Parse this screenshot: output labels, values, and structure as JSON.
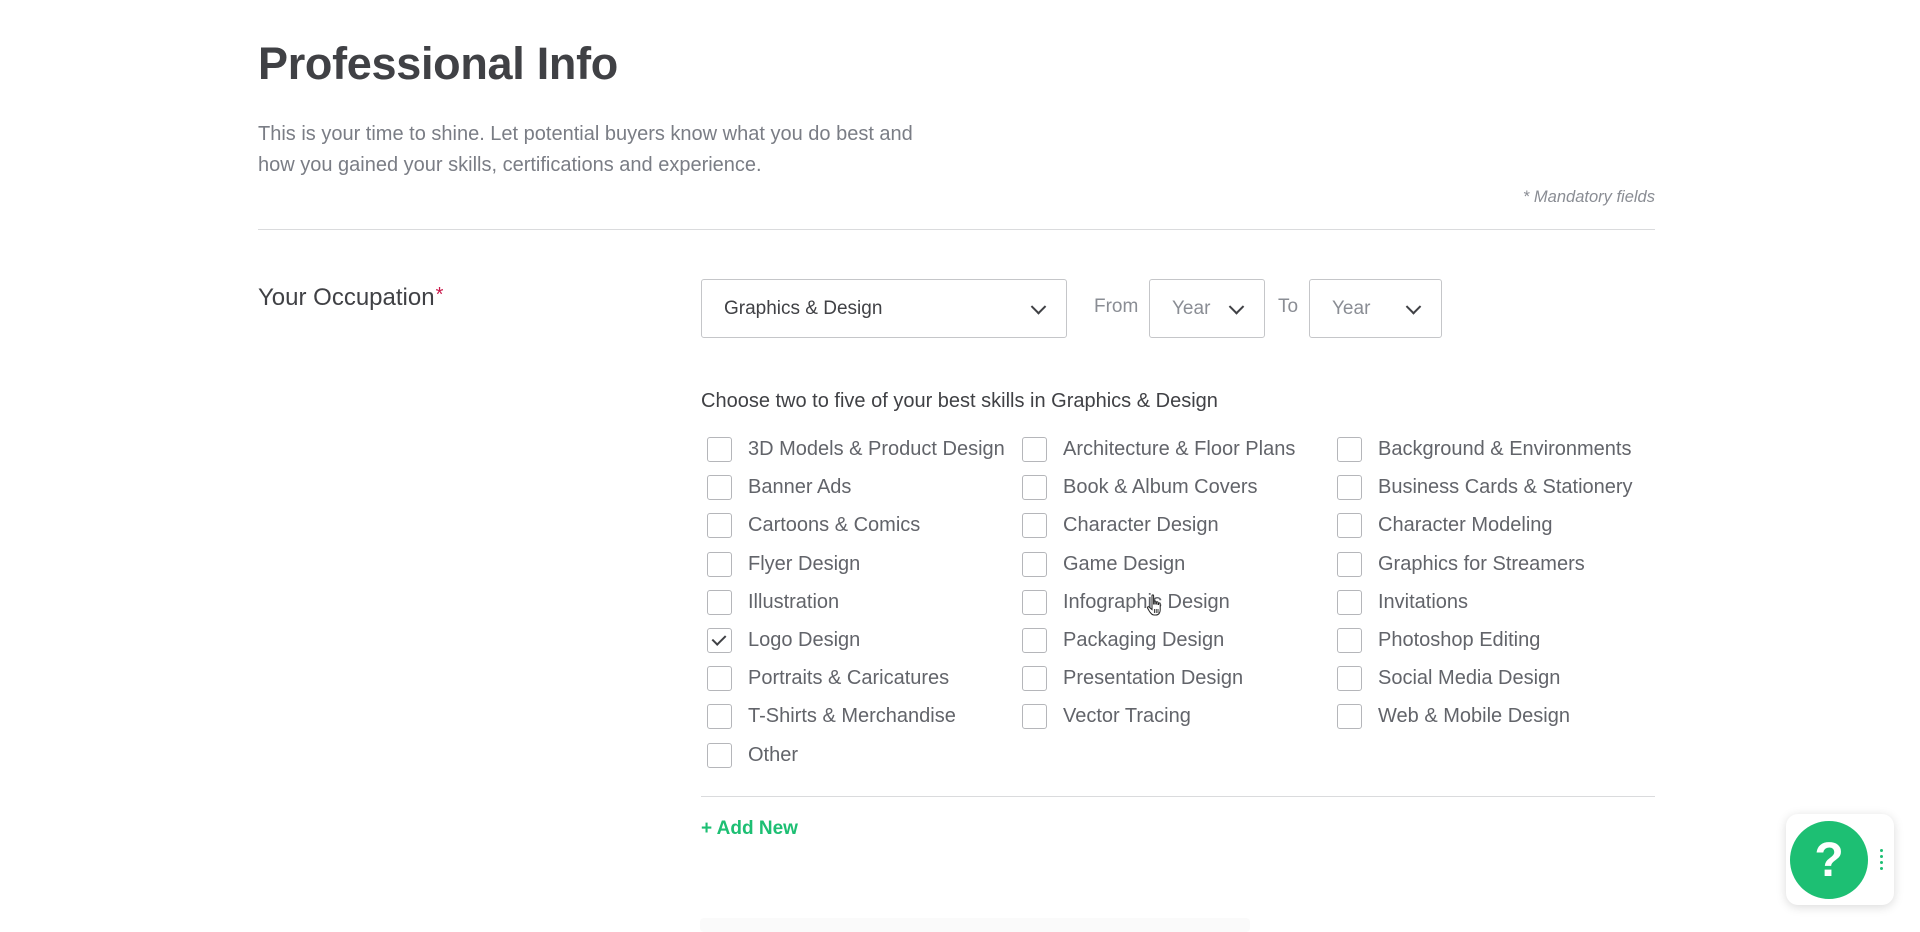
{
  "page": {
    "title": "Professional Info",
    "intro": "This is your time to shine. Let potential buyers know what you do best and how you gained your skills, certifications and experience.",
    "mandatory_note": "* Mandatory fields"
  },
  "occupation": {
    "label": "Your Occupation",
    "required_mark": "*",
    "selected": "Graphics & Design",
    "from_label": "From",
    "from_value": "Year",
    "to_label": "To",
    "to_value": "Year"
  },
  "skills": {
    "prompt": "Choose two to five of your best skills in Graphics & Design",
    "items": [
      {
        "label": "3D Models & Product Design",
        "checked": false
      },
      {
        "label": "Architecture & Floor Plans",
        "checked": false
      },
      {
        "label": "Background & Environments",
        "checked": false
      },
      {
        "label": "Banner Ads",
        "checked": false
      },
      {
        "label": "Book & Album Covers",
        "checked": false
      },
      {
        "label": "Business Cards & Stationery",
        "checked": false
      },
      {
        "label": "Cartoons & Comics",
        "checked": false
      },
      {
        "label": "Character Design",
        "checked": false
      },
      {
        "label": "Character Modeling",
        "checked": false
      },
      {
        "label": "Flyer Design",
        "checked": false
      },
      {
        "label": "Game Design",
        "checked": false
      },
      {
        "label": "Graphics for Streamers",
        "checked": false
      },
      {
        "label": "Illustration",
        "checked": false
      },
      {
        "label": "Infographic Design",
        "checked": false
      },
      {
        "label": "Invitations",
        "checked": false
      },
      {
        "label": "Logo Design",
        "checked": true
      },
      {
        "label": "Packaging Design",
        "checked": false
      },
      {
        "label": "Photoshop Editing",
        "checked": false
      },
      {
        "label": "Portraits & Caricatures",
        "checked": false
      },
      {
        "label": "Presentation Design",
        "checked": false
      },
      {
        "label": "Social Media Design",
        "checked": false
      },
      {
        "label": "T-Shirts & Merchandise",
        "checked": false
      },
      {
        "label": "Vector Tracing",
        "checked": false
      },
      {
        "label": "Web & Mobile Design",
        "checked": false
      },
      {
        "label": "Other",
        "checked": false
      }
    ]
  },
  "actions": {
    "add_new": "+ Add New"
  },
  "help_widget": {
    "icon": "question-mark-icon",
    "glyph": "?",
    "accent": "#1dbf73"
  },
  "colors": {
    "accent": "#1dbf73",
    "required": "#c9184a",
    "text": "#404145"
  }
}
